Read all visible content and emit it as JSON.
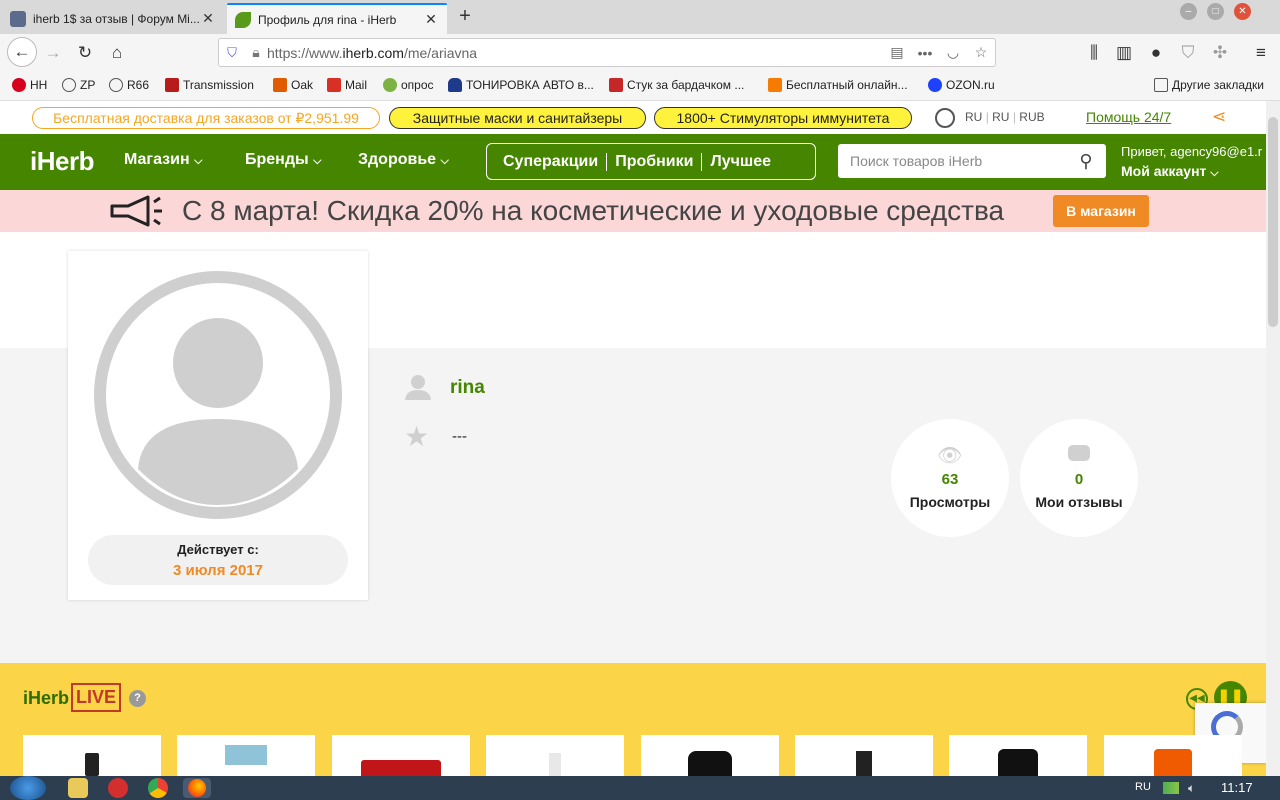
{
  "browser": {
    "tabs": [
      {
        "title": "iherb 1$ за отзыв | Форум Мі...",
        "active": false
      },
      {
        "title": "Профиль для rina - iHerb",
        "active": true
      }
    ],
    "url_prefix": "https://www.",
    "url_host": "iherb.com",
    "url_path": "/me/ariavna",
    "bookmarks": [
      {
        "label": "HH",
        "icon": "hh-icon",
        "color": "#d6001c"
      },
      {
        "label": "ZP",
        "icon": "globe-icon",
        "color": "#555"
      },
      {
        "label": "R66",
        "icon": "globe-icon",
        "color": "#555"
      },
      {
        "label": "Transmission",
        "icon": "transmission-icon",
        "color": "#b71c1c"
      },
      {
        "label": "Oak",
        "icon": "oak-icon",
        "color": "#e05a00"
      },
      {
        "label": "Mail",
        "icon": "mail-icon",
        "color": "#d93025"
      },
      {
        "label": "опрос",
        "icon": "survey-icon",
        "color": "#7cb342"
      },
      {
        "label": "ТОНИРОВКА АВТО в...",
        "icon": "car-icon",
        "color": "#1e3a8a"
      },
      {
        "label": "Стук за бардачком ...",
        "icon": "d-icon",
        "color": "#c62828"
      },
      {
        "label": "Бесплатный онлайн...",
        "icon": "sms-icon",
        "color": "#f57c00"
      },
      {
        "label": "OZON.ru",
        "icon": "ozon-icon",
        "color": "#1e40ff"
      }
    ],
    "other_bookmarks": "Другие закладки"
  },
  "topstrip": {
    "free_shipping": "Бесплатная доставка для заказов от ₽2,951.99",
    "promo1": "Защитные маски и санитайзеры",
    "promo2": "1800+ Стимуляторы иммунитета",
    "lang": "RU",
    "country": "RU",
    "currency": "RUB",
    "help": "Помощь 24/7"
  },
  "header": {
    "logo": "iHerb",
    "nav": [
      "Магазин",
      "Бренды",
      "Здоровье"
    ],
    "deals": [
      "Суперакции",
      "Пробники",
      "Лучшее"
    ],
    "search_placeholder": "Поиск товаров iHerb",
    "greeting": "Привет, agency96@e1.r",
    "account": "Мой аккаунт"
  },
  "banner": {
    "text": "С 8 марта! Скидка 20% на косметические и уходовые средства",
    "button": "В магазин"
  },
  "profile": {
    "member_since_label": "Действует с:",
    "member_since_date": "3 июля 2017",
    "username": "rina",
    "rating": "---",
    "stats": [
      {
        "value": "63",
        "label": "Просмотры",
        "icon": "eye-icon"
      },
      {
        "value": "0",
        "label": "Мои отзывы",
        "icon": "comment-icon"
      }
    ]
  },
  "live": {
    "brand": "iHerb",
    "badge": "LIVE"
  },
  "taskbar": {
    "lang": "RU",
    "time": "11:17"
  },
  "colors": {
    "brand_green": "#458500",
    "accent_orange": "#f08a24",
    "promo_yellow": "#fff23d",
    "banner_pink": "#fbd7d7",
    "live_yellow": "#fbd448"
  }
}
